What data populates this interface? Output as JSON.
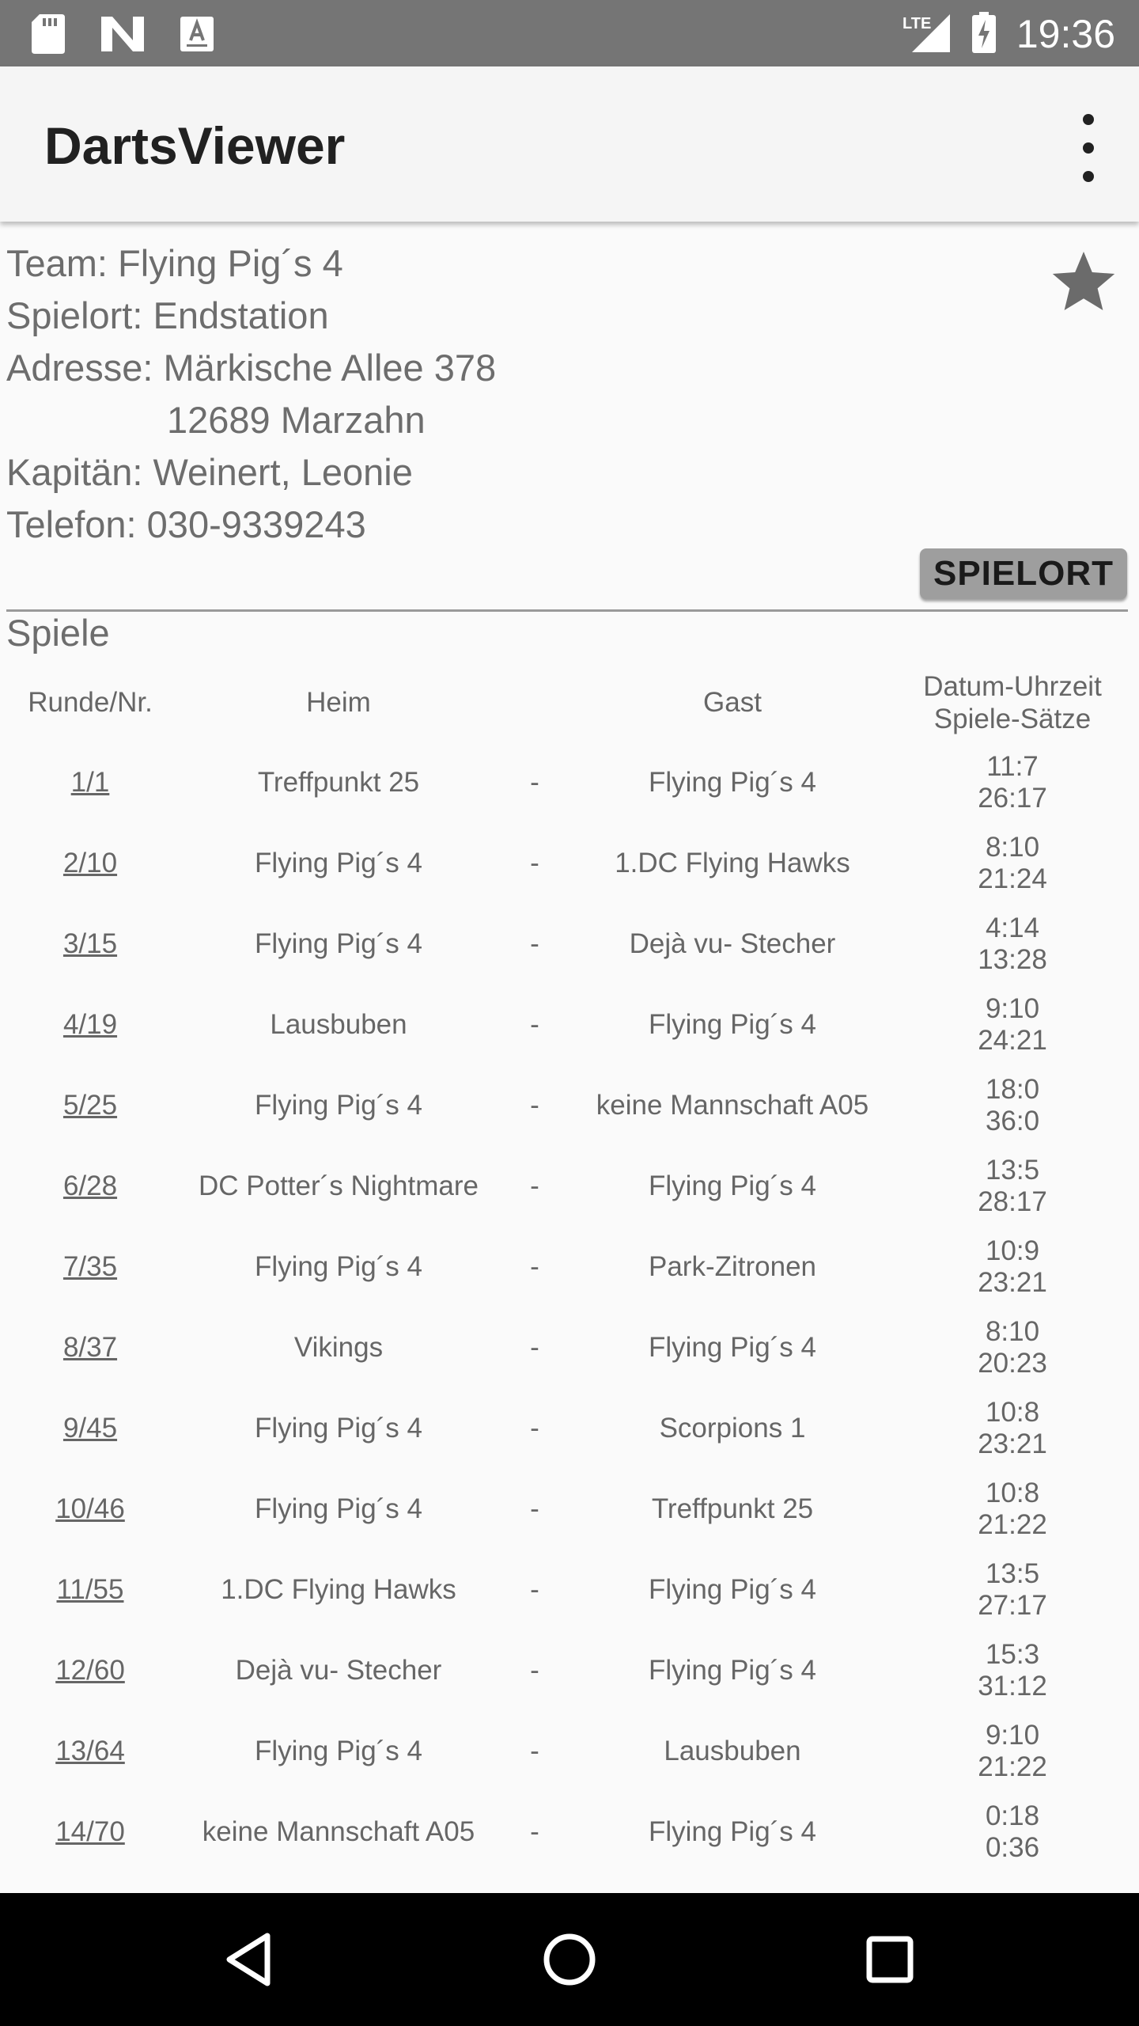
{
  "status_bar": {
    "time": "19:36",
    "network": "LTE",
    "icons": [
      "sd-card-icon",
      "n-notification-icon",
      "a-notification-icon",
      "signal-icon",
      "battery-charging-icon"
    ]
  },
  "app_bar": {
    "title": "DartsViewer",
    "overflow_icon": "more-vert-icon"
  },
  "team": {
    "team_line": "Team: Flying Pig´s 4",
    "spielort_line": "Spielort: Endstation",
    "adresse_line": "Adresse: Märkische Allee 378",
    "adresse_line2": "12689 Marzahn",
    "kapitaen_line": "Kapitän:  Weinert, Leonie",
    "telefon_line": "Telefon:  030-9339243",
    "favorite_icon": "star-icon",
    "spielort_button": "SPIELORT"
  },
  "games": {
    "section_title": "Spiele",
    "headers": {
      "runde": "Runde/Nr.",
      "heim": "Heim",
      "gast": "Gast",
      "datum_line1": "Datum-Uhrzeit",
      "datum_line2": "Spiele-Sätze"
    },
    "rows": [
      {
        "runde": "1/1",
        "heim": "Treffpunkt 25",
        "sep": "-",
        "gast": "Flying Pig´s 4",
        "spiele": "11:7",
        "saetze": "26:17"
      },
      {
        "runde": "2/10",
        "heim": "Flying Pig´s 4",
        "sep": "-",
        "gast": "1.DC Flying Hawks",
        "spiele": "8:10",
        "saetze": "21:24"
      },
      {
        "runde": "3/15",
        "heim": "Flying Pig´s 4",
        "sep": "-",
        "gast": "Dejà vu- Stecher",
        "spiele": "4:14",
        "saetze": "13:28"
      },
      {
        "runde": "4/19",
        "heim": "Lausbuben",
        "sep": "-",
        "gast": "Flying Pig´s 4",
        "spiele": "9:10",
        "saetze": "24:21"
      },
      {
        "runde": "5/25",
        "heim": "Flying Pig´s 4",
        "sep": "-",
        "gast": "keine Mannschaft A05",
        "spiele": "18:0",
        "saetze": "36:0"
      },
      {
        "runde": "6/28",
        "heim": "DC Potter´s Nightmare",
        "sep": "-",
        "gast": "Flying Pig´s 4",
        "spiele": "13:5",
        "saetze": "28:17"
      },
      {
        "runde": "7/35",
        "heim": "Flying Pig´s 4",
        "sep": "-",
        "gast": "Park-Zitronen",
        "spiele": "10:9",
        "saetze": "23:21"
      },
      {
        "runde": "8/37",
        "heim": "Vikings",
        "sep": "-",
        "gast": "Flying Pig´s 4",
        "spiele": "8:10",
        "saetze": "20:23"
      },
      {
        "runde": "9/45",
        "heim": "Flying Pig´s 4",
        "sep": "-",
        "gast": "Scorpions 1",
        "spiele": "10:8",
        "saetze": "23:21"
      },
      {
        "runde": "10/46",
        "heim": "Flying Pig´s 4",
        "sep": "-",
        "gast": "Treffpunkt 25",
        "spiele": "10:8",
        "saetze": "21:22"
      },
      {
        "runde": "11/55",
        "heim": "1.DC Flying Hawks",
        "sep": "-",
        "gast": "Flying Pig´s 4",
        "spiele": "13:5",
        "saetze": "27:17"
      },
      {
        "runde": "12/60",
        "heim": "Dejà vu- Stecher",
        "sep": "-",
        "gast": "Flying Pig´s 4",
        "spiele": "15:3",
        "saetze": "31:12"
      },
      {
        "runde": "13/64",
        "heim": "Flying Pig´s 4",
        "sep": "-",
        "gast": "Lausbuben",
        "spiele": "9:10",
        "saetze": "21:22"
      },
      {
        "runde": "14/70",
        "heim": "keine Mannschaft A05",
        "sep": "-",
        "gast": "Flying Pig´s 4",
        "spiele": "0:18",
        "saetze": "0:36"
      }
    ]
  },
  "nav_bar": {
    "back_icon": "back-triangle-icon",
    "home_icon": "home-circle-icon",
    "recents_icon": "recents-square-icon"
  }
}
